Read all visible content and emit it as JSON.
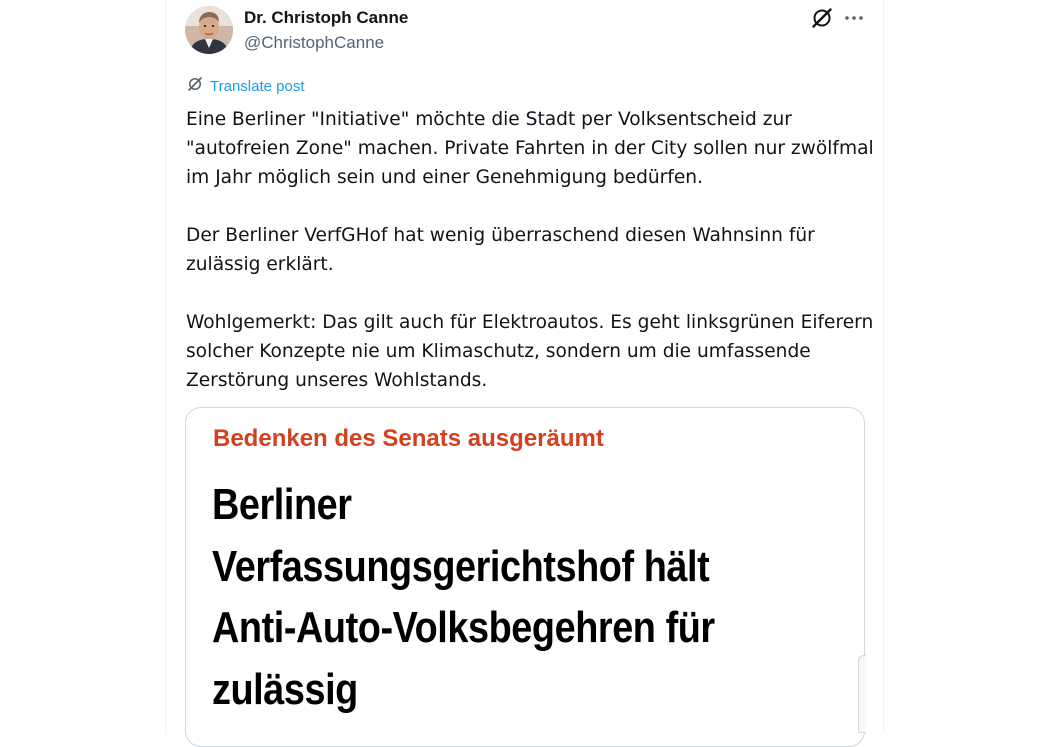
{
  "post": {
    "author": {
      "name": "Dr. Christoph Canne",
      "handle": "@ChristophCanne"
    },
    "translate_label": "Translate post",
    "paragraphs": [
      "Eine Berliner \"Initiative\" möchte die Stadt per Volksentscheid zur\n\"autofreien Zone\" machen. Private Fahrten in der City sollen nur zwölfmal\nim Jahr möglich sein und  einer Genehmigung bedürfen.",
      "Der Berliner VerfGHof hat wenig überraschend diesen Wahnsinn für\nzulässig erklärt.",
      "Wohlgemerkt: Das gilt auch für Elektroautos. Es geht linksgrünen Eiferern\nsolcher Konzepte nie um Klimaschutz, sondern um die umfassende\nZerstörung unseres Wohlstands."
    ],
    "media": {
      "kicker": "Bedenken des Senats ausgeräumt",
      "headline": "Berliner\nVerfassungsgerichtshof hält\nAnti-Auto-Volksbegehren für\nzulässig"
    }
  },
  "icons": {
    "grok": "grok-icon",
    "more": "more-icon",
    "translate": "translate-icon"
  },
  "colors": {
    "link": "#1d9bf0",
    "text": "#0f1419",
    "secondary": "#536471",
    "kicker": "#d4411e",
    "border": "#cfd9de"
  }
}
